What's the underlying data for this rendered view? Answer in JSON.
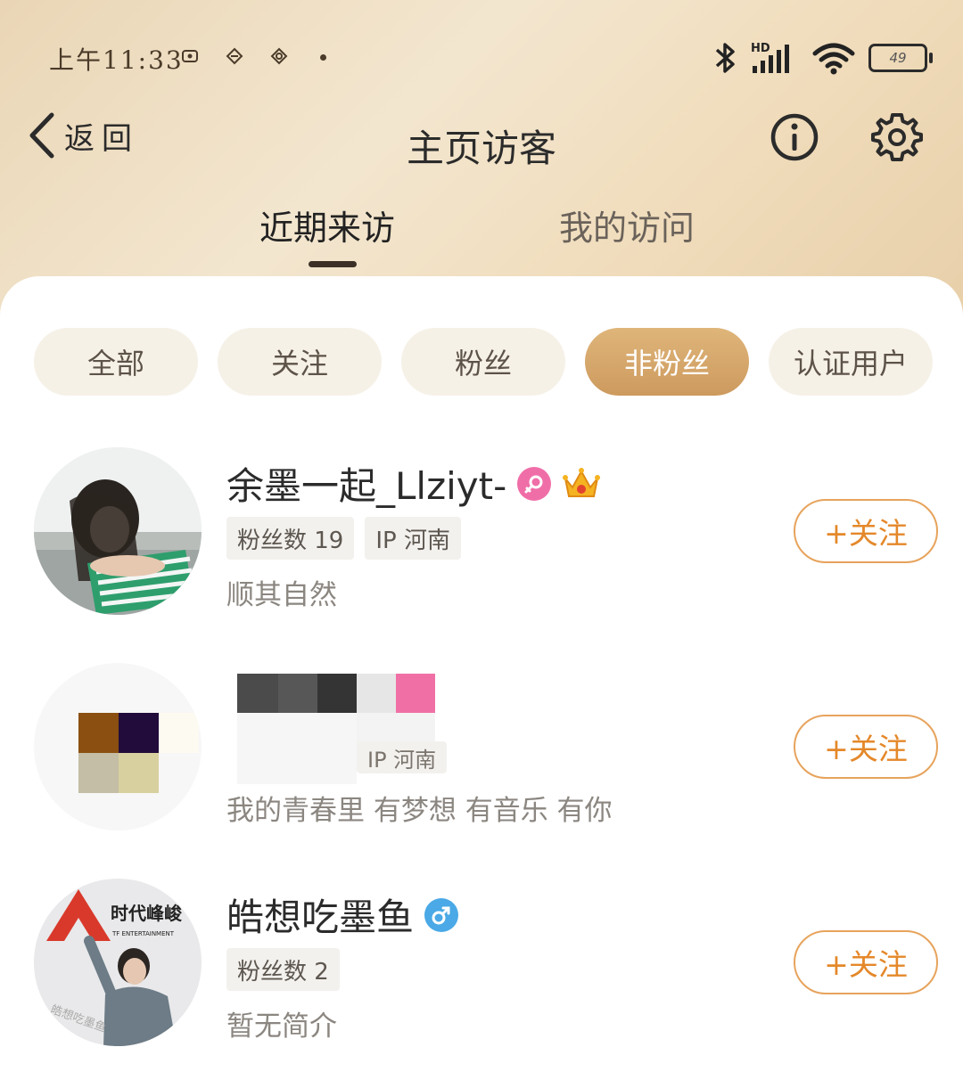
{
  "status_bar": {
    "time": "上午11:33",
    "battery": "49"
  },
  "nav": {
    "back_label": "返回",
    "title": "主页访客"
  },
  "tabs": [
    {
      "label": "近期来访",
      "active": true
    },
    {
      "label": "我的访问",
      "active": false
    }
  ],
  "filters": [
    {
      "label": "全部",
      "active": false
    },
    {
      "label": "关注",
      "active": false
    },
    {
      "label": "粉丝",
      "active": false
    },
    {
      "label": "非粉丝",
      "active": true
    },
    {
      "label": "认证用户",
      "active": false
    }
  ],
  "visitors": [
    {
      "name": "余墨一起_Llziyt-",
      "gender": "female",
      "fans": "粉丝数 19",
      "ip": "IP 河南",
      "bio": "顺其自然",
      "follow_label": "+关注"
    },
    {
      "name": "",
      "gender": "",
      "fans": "",
      "ip": "IP 河南",
      "bio": "我的青春里 有梦想 有音乐 有你",
      "follow_label": "+关注",
      "redacted": true
    },
    {
      "name": "皓想吃墨鱼",
      "gender": "male",
      "fans": "粉丝数 2",
      "ip": "",
      "bio": "暂无简介",
      "follow_label": "+关注"
    }
  ],
  "colors": {
    "accent": "#e4882a",
    "chip_active": "#d4a56a",
    "header": "#efdcbd"
  }
}
